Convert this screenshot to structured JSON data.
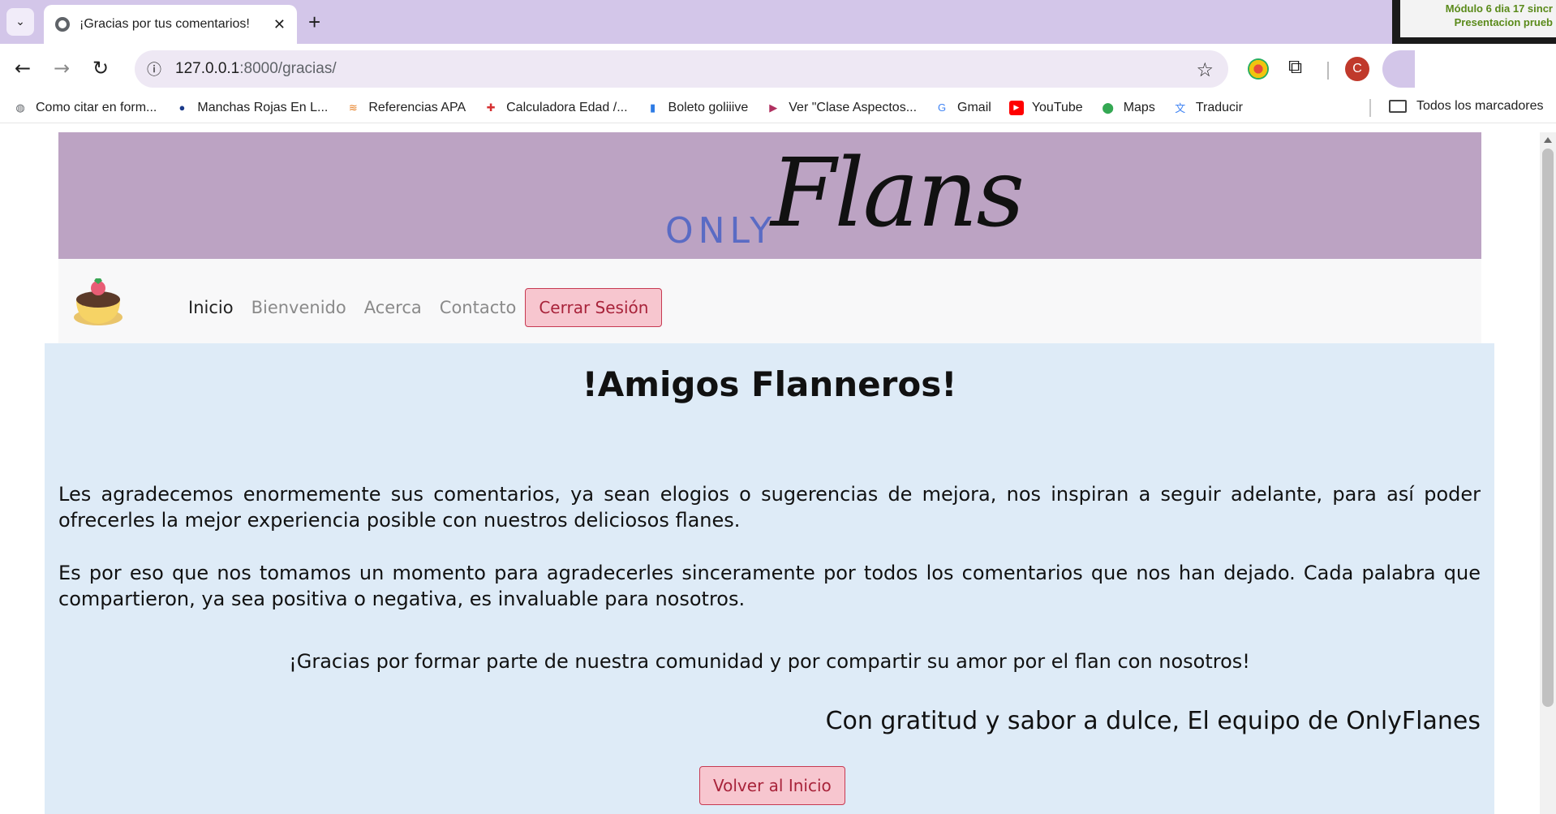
{
  "browser": {
    "tab_title": "¡Gracias por tus comentarios!",
    "url_host": "127.0.0.1",
    "url_rest": ":8000/gracias/",
    "profile_initial": "C",
    "pip_text": "Módulo 6 dia 17 sincr Presentacion prueb"
  },
  "bookmarks": [
    {
      "label": "Como citar en form...",
      "icon": "globe-icon",
      "color": "#5f6368"
    },
    {
      "label": "Manchas Rojas En L...",
      "icon": "apple-icon",
      "color": "#1b3a8a"
    },
    {
      "label": "Referencias APA",
      "icon": "apa-icon",
      "color": "#e67e22"
    },
    {
      "label": "Calculadora Edad /...",
      "icon": "calculator-icon",
      "color": "#d63031"
    },
    {
      "label": "Boleto goliiive",
      "icon": "bars-icon",
      "color": "#2d7be5"
    },
    {
      "label": "Ver \"Clase Aspectos...",
      "icon": "play-icon",
      "color": "#b03060"
    },
    {
      "label": "Gmail",
      "icon": "google-icon",
      "color": "#4285f4"
    },
    {
      "label": "YouTube",
      "icon": "youtube-icon",
      "color": "#ff0000"
    },
    {
      "label": "Maps",
      "icon": "maps-icon",
      "color": "#34a853"
    },
    {
      "label": "Traducir",
      "icon": "translate-icon",
      "color": "#4285f4"
    }
  ],
  "bookmarks_all": "Todos los marcadores",
  "site": {
    "logo_only": "ONLY",
    "logo_flans": "Flans",
    "nav": [
      "Inicio",
      "Bienvenido",
      "Acerca",
      "Contacto"
    ],
    "logout": "Cerrar Sesión"
  },
  "content": {
    "heading": "!Amigos Flanneros!",
    "p1": "Les agradecemos enormemente sus comentarios, ya sean elogios o sugerencias de mejora, nos inspiran a seguir adelante, para así poder ofrecerles la mejor experiencia posible con nuestros deliciosos flanes.",
    "p2": "Es por eso que nos tomamos un momento para agradecerles sinceramente por todos los comentarios que nos han dejado. Cada palabra que compartieron, ya sea positiva o negativa, es invaluable para nosotros.",
    "p3": "¡Gracias por formar parte de nuestra comunidad y por compartir su amor por el flan con nosotros!",
    "signoff": "Con gratitud y sabor a dulce, El equipo de OnlyFlanes",
    "back_button": "Volver al Inicio"
  }
}
